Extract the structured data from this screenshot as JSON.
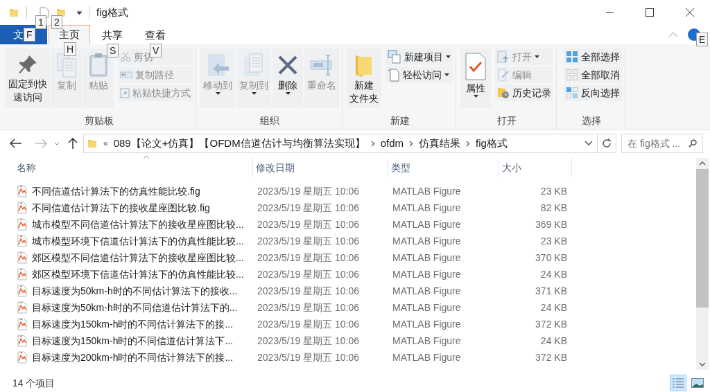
{
  "title_bar": {
    "title": "fig格式",
    "quick_access": [
      {
        "keytip": "1"
      },
      {
        "keytip": "2"
      }
    ]
  },
  "ribbon_tabs": [
    {
      "label": "文",
      "kind": "file",
      "selected": false,
      "keytip": "F"
    },
    {
      "label": "主页",
      "kind": "tab",
      "selected": true,
      "keytip": "H"
    },
    {
      "label": "共享",
      "kind": "tab",
      "selected": false,
      "keytip": "S"
    },
    {
      "label": "查看",
      "kind": "tab",
      "selected": false,
      "keytip": "V"
    }
  ],
  "help": {
    "keytip": "E"
  },
  "ribbon_groups": [
    {
      "label": "剪贴板",
      "items": [
        {
          "kind": "large",
          "label": "固定到快速访问",
          "disabled": false,
          "dropdown": false
        },
        {
          "kind": "large",
          "label": "复制",
          "disabled": true,
          "dropdown": false
        },
        {
          "kind": "large",
          "label": "粘贴",
          "disabled": true,
          "dropdown": false
        },
        {
          "kind": "small",
          "label": "剪切",
          "disabled": true,
          "dropdown": false
        },
        {
          "kind": "small",
          "label": "复制路径",
          "disabled": true,
          "dropdown": false
        },
        {
          "kind": "small",
          "label": "粘贴快捷方式",
          "disabled": true,
          "dropdown": false
        }
      ]
    },
    {
      "label": "组织",
      "items": [
        {
          "kind": "large",
          "label": "移动到",
          "disabled": true,
          "dropdown": true
        },
        {
          "kind": "large",
          "label": "复制到",
          "disabled": true,
          "dropdown": true
        },
        {
          "kind": "large",
          "label": "删除",
          "disabled": false,
          "dropdown": true
        },
        {
          "kind": "large",
          "label": "重命名",
          "disabled": true,
          "dropdown": false
        }
      ]
    },
    {
      "label": "新建",
      "items": [
        {
          "kind": "large",
          "label": "新建文件夹",
          "disabled": false,
          "dropdown": false
        },
        {
          "kind": "small",
          "label": "新建项目",
          "disabled": false,
          "dropdown": true
        },
        {
          "kind": "small",
          "label": "轻松访问",
          "disabled": false,
          "dropdown": true
        }
      ]
    },
    {
      "label": "打开",
      "items": [
        {
          "kind": "large",
          "label": "属性",
          "disabled": false,
          "dropdown": true
        },
        {
          "kind": "small",
          "label": "打开",
          "disabled": true,
          "dropdown": true
        },
        {
          "kind": "small",
          "label": "编辑",
          "disabled": true,
          "dropdown": false
        },
        {
          "kind": "small",
          "label": "历史记录",
          "disabled": false,
          "dropdown": false
        }
      ]
    },
    {
      "label": "选择",
      "items": [
        {
          "kind": "small",
          "label": "全部选择",
          "disabled": false,
          "dropdown": false
        },
        {
          "kind": "small",
          "label": "全部取消",
          "disabled": false,
          "dropdown": false
        },
        {
          "kind": "small",
          "label": "反向选择",
          "disabled": false,
          "dropdown": false
        }
      ]
    }
  ],
  "address_bar": {
    "overflow": "«",
    "breadcrumbs": [
      "089【论文+仿真】【OFDM信道估计与均衡算法实现】",
      "ofdm",
      "仿真结果",
      "fig格式"
    ]
  },
  "search": {
    "placeholder": "在 fig格式 ..."
  },
  "table": {
    "columns": [
      "名称",
      "修改日期",
      "类型",
      "大小"
    ],
    "rows": [
      {
        "name": "不同信道估计算法下的仿真性能比较.fig",
        "modified": "2023/5/19 星期五 10:06",
        "type": "MATLAB Figure",
        "size": "23 KB"
      },
      {
        "name": "不同信道估计算法下的接收星座图比较.fig",
        "modified": "2023/5/19 星期五 10:06",
        "type": "MATLAB Figure",
        "size": "82 KB"
      },
      {
        "name": "城市模型不同信道估计算法下的接收星座图比较...",
        "modified": "2023/5/19 星期五 10:06",
        "type": "MATLAB Figure",
        "size": "369 KB"
      },
      {
        "name": "城市模型环境下信道估计算法下的仿真性能比较...",
        "modified": "2023/5/19 星期五 10:06",
        "type": "MATLAB Figure",
        "size": "23 KB"
      },
      {
        "name": "郊区模型不同信道估计算法下的接收星座图比较...",
        "modified": "2023/5/19 星期五 10:06",
        "type": "MATLAB Figure",
        "size": "370 KB"
      },
      {
        "name": "郊区模型环境下信道估计算法下的仿真性能比较...",
        "modified": "2023/5/19 星期五 10:06",
        "type": "MATLAB Figure",
        "size": "24 KB"
      },
      {
        "name": "目标速度为50km-h时的不同估计算法下的接收...",
        "modified": "2023/5/19 星期五 10:06",
        "type": "MATLAB Figure",
        "size": "371 KB"
      },
      {
        "name": "目标速度为50km-h时的不同信道估计算法下的...",
        "modified": "2023/5/19 星期五 10:06",
        "type": "MATLAB Figure",
        "size": "24 KB"
      },
      {
        "name": "目标速度为150km-h时的不同估计算法下的接...",
        "modified": "2023/5/19 星期五 10:06",
        "type": "MATLAB Figure",
        "size": "372 KB"
      },
      {
        "name": "目标速度为150km-h时的不同信道估计算法下...",
        "modified": "2023/5/19 星期五 10:06",
        "type": "MATLAB Figure",
        "size": "24 KB"
      },
      {
        "name": "目标速度为200km-h时的不同估计算法下的接...",
        "modified": "2023/5/19 星期五 10:06",
        "type": "MATLAB Figure",
        "size": "372 KB"
      }
    ]
  },
  "status_bar": {
    "item_count": "14 个项目",
    "views": [
      {
        "selected": true
      },
      {
        "selected": false
      }
    ]
  }
}
